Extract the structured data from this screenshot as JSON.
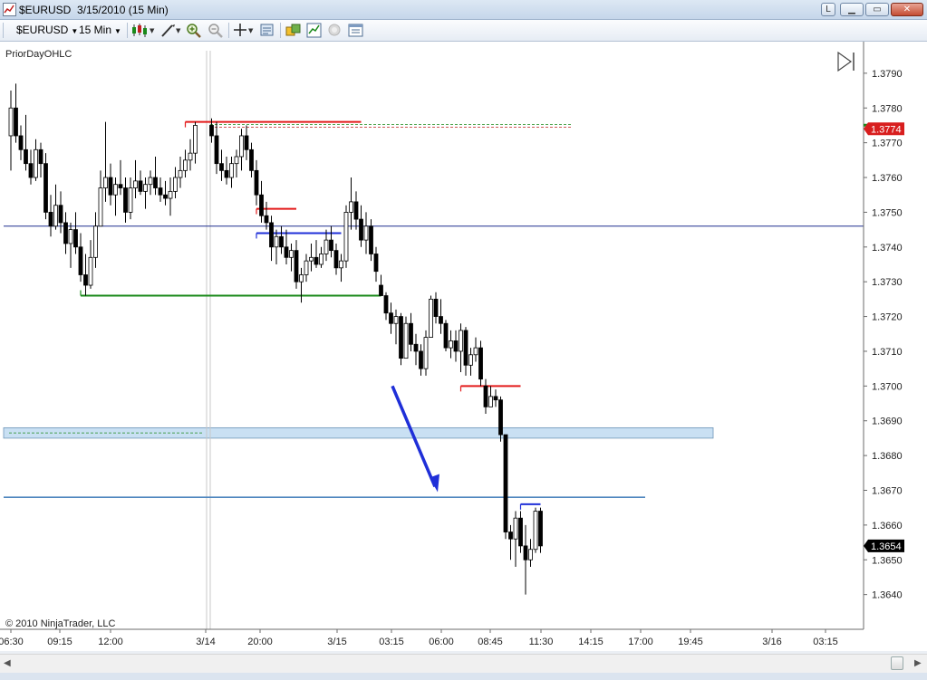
{
  "window": {
    "title": "$EURUSD  3/15/2010 (15 Min)",
    "buttons": [
      "L",
      "▁",
      "▭",
      "✕"
    ]
  },
  "toolbar": {
    "instrument": "$EURUSD",
    "interval": "15 Min"
  },
  "chart_data": {
    "type": "candlestick",
    "indicator_label": "PriorDayOHLC",
    "copyright": "© 2010 NinjaTrader, LLC",
    "y_ticks": [
      "1.3790",
      "1.3780",
      "1.3770",
      "1.3760",
      "1.3750",
      "1.3740",
      "1.3730",
      "1.3720",
      "1.3710",
      "1.3700",
      "1.3690",
      "1.3680",
      "1.3670",
      "1.3660",
      "1.3650",
      "1.3640"
    ],
    "ylim": [
      1.3636,
      1.3797
    ],
    "x_ticks": [
      "06:30",
      "09:15",
      "12:00",
      "3/14",
      "20:00",
      "3/15",
      "03:15",
      "06:00",
      "08:45",
      "11:30",
      "14:15",
      "17:00",
      "19:45",
      "3/16",
      "03:15"
    ],
    "last_price": "1.3654",
    "ask_marker": "1.3774",
    "colors": {
      "candle": "#000000",
      "red_level": "#e31b1b",
      "green_level": "#1a8a1a",
      "blue_level": "#1f2fd8",
      "navy_line": "#1f2f8f",
      "band": "#c9e0f3",
      "arrow": "#1f2fd8"
    },
    "bars_a": [
      [
        1.3762,
        1.3785,
        1.3772,
        1.378
      ],
      [
        1.377,
        1.3787,
        1.378,
        1.3772
      ],
      [
        1.3765,
        1.3775,
        1.3772,
        1.3768
      ],
      [
        1.3762,
        1.3778,
        1.3768,
        1.3764
      ],
      [
        1.3758,
        1.3768,
        1.3764,
        1.376
      ],
      [
        1.3759,
        1.3771,
        1.376,
        1.3768
      ],
      [
        1.376,
        1.377,
        1.3768,
        1.3764
      ],
      [
        1.3748,
        1.3767,
        1.3764,
        1.375
      ],
      [
        1.3743,
        1.3755,
        1.375,
        1.3746
      ],
      [
        1.3745,
        1.3758,
        1.3746,
        1.3752
      ],
      [
        1.3744,
        1.3756,
        1.3752,
        1.3747
      ],
      [
        1.3738,
        1.375,
        1.3747,
        1.3741
      ],
      [
        1.3734,
        1.3747,
        1.3741,
        1.3745
      ],
      [
        1.3738,
        1.375,
        1.3745,
        1.374
      ],
      [
        1.373,
        1.3744,
        1.374,
        1.3732
      ],
      [
        1.3726,
        1.3738,
        1.3732,
        1.3729
      ],
      [
        1.3728,
        1.3742,
        1.3729,
        1.3737
      ],
      [
        1.3734,
        1.375,
        1.3737,
        1.3746
      ],
      [
        1.3746,
        1.3762,
        1.3746,
        1.3757
      ],
      [
        1.3753,
        1.3776,
        1.3757,
        1.376
      ],
      [
        1.3752,
        1.3764,
        1.376,
        1.3755
      ],
      [
        1.3749,
        1.376,
        1.3755,
        1.3758
      ],
      [
        1.3755,
        1.3765,
        1.3758,
        1.3757
      ],
      [
        1.3747,
        1.376,
        1.3757,
        1.375
      ],
      [
        1.3748,
        1.376,
        1.375,
        1.3757
      ],
      [
        1.3754,
        1.3765,
        1.3757,
        1.3759
      ],
      [
        1.3755,
        1.3762,
        1.3759,
        1.3756
      ],
      [
        1.3751,
        1.376,
        1.3756,
        1.3758
      ],
      [
        1.3755,
        1.3762,
        1.3758,
        1.376
      ],
      [
        1.3755,
        1.3766,
        1.376,
        1.3757
      ],
      [
        1.3753,
        1.376,
        1.3757,
        1.3755
      ],
      [
        1.3752,
        1.3759,
        1.3755,
        1.3754
      ],
      [
        1.3749,
        1.376,
        1.3754,
        1.3756
      ],
      [
        1.3754,
        1.3763,
        1.3756,
        1.376
      ],
      [
        1.3757,
        1.3766,
        1.376,
        1.3762
      ],
      [
        1.376,
        1.3768,
        1.3762,
        1.3765
      ],
      [
        1.3762,
        1.3771,
        1.3765,
        1.3767
      ],
      [
        1.3764,
        1.3776,
        1.3767,
        1.3775
      ]
    ],
    "bars_b": [
      [
        1.377,
        1.3777,
        1.3775,
        1.3772
      ],
      [
        1.3761,
        1.3776,
        1.3772,
        1.3764
      ],
      [
        1.3759,
        1.3768,
        1.3764,
        1.3762
      ],
      [
        1.3758,
        1.3766,
        1.3762,
        1.376
      ],
      [
        1.3757,
        1.3766,
        1.376,
        1.3764
      ],
      [
        1.376,
        1.3768,
        1.3764,
        1.3766
      ],
      [
        1.3762,
        1.3774,
        1.3766,
        1.3772
      ],
      [
        1.3765,
        1.3775,
        1.3772,
        1.3768
      ],
      [
        1.376,
        1.377,
        1.3768,
        1.3762
      ],
      [
        1.3752,
        1.3765,
        1.3762,
        1.3755
      ],
      [
        1.3747,
        1.3759,
        1.3755,
        1.3749
      ],
      [
        1.3745,
        1.3753,
        1.3749,
        1.3747
      ],
      [
        1.3736,
        1.3749,
        1.3747,
        1.374
      ],
      [
        1.3735,
        1.3745,
        1.374,
        1.3743
      ],
      [
        1.3738,
        1.3746,
        1.3743,
        1.374
      ],
      [
        1.3735,
        1.3745,
        1.374,
        1.3737
      ],
      [
        1.3733,
        1.3741,
        1.3737,
        1.3739
      ],
      [
        1.3728,
        1.3742,
        1.3739,
        1.373
      ],
      [
        1.3724,
        1.3734,
        1.373,
        1.3732
      ],
      [
        1.373,
        1.3738,
        1.3732,
        1.3736
      ],
      [
        1.3733,
        1.3741,
        1.3736,
        1.3737
      ],
      [
        1.3734,
        1.3742,
        1.3737,
        1.3735
      ],
      [
        1.3734,
        1.374,
        1.3735,
        1.3738
      ],
      [
        1.3736,
        1.3745,
        1.3738,
        1.3742
      ],
      [
        1.3737,
        1.3746,
        1.3742,
        1.3739
      ],
      [
        1.3732,
        1.3741,
        1.3739,
        1.3734
      ],
      [
        1.373,
        1.3738,
        1.3734,
        1.3736
      ],
      [
        1.3734,
        1.3752,
        1.3736,
        1.375
      ],
      [
        1.3745,
        1.376,
        1.375,
        1.3753
      ],
      [
        1.3745,
        1.3756,
        1.3753,
        1.3748
      ],
      [
        1.374,
        1.3752,
        1.3748,
        1.3742
      ],
      [
        1.3738,
        1.375,
        1.3742,
        1.3746
      ],
      [
        1.3736,
        1.3748,
        1.3746,
        1.3738
      ],
      [
        1.373,
        1.374,
        1.3738,
        1.3733
      ],
      [
        1.3728,
        1.3732,
        1.3729,
        1.3726
      ],
      [
        1.3719,
        1.3727,
        1.3726,
        1.3721
      ],
      [
        1.3715,
        1.3724,
        1.3721,
        1.3718
      ],
      [
        1.3712,
        1.3722,
        1.3718,
        1.372
      ],
      [
        1.3706,
        1.3721,
        1.372,
        1.3708
      ],
      [
        1.3708,
        1.372,
        1.3708,
        1.3718
      ],
      [
        1.371,
        1.3721,
        1.3718,
        1.3712
      ],
      [
        1.3706,
        1.3715,
        1.3712,
        1.371
      ],
      [
        1.3703,
        1.3712,
        1.371,
        1.3705
      ],
      [
        1.3703,
        1.3716,
        1.3705,
        1.3714
      ],
      [
        1.3714,
        1.3726,
        1.3714,
        1.3725
      ],
      [
        1.3718,
        1.3727,
        1.3725,
        1.372
      ],
      [
        1.3715,
        1.3725,
        1.372,
        1.3718
      ],
      [
        1.371,
        1.3719,
        1.3718,
        1.3711
      ],
      [
        1.3708,
        1.3716,
        1.3711,
        1.3713
      ],
      [
        1.3707,
        1.3716,
        1.3713,
        1.371
      ],
      [
        1.3704,
        1.3718,
        1.371,
        1.3716
      ],
      [
        1.3703,
        1.3717,
        1.3716,
        1.3706
      ],
      [
        1.3703,
        1.3711,
        1.3706,
        1.3709
      ],
      [
        1.3707,
        1.3714,
        1.3709,
        1.3711
      ],
      [
        1.37,
        1.3713,
        1.3711,
        1.3702
      ],
      [
        1.3692,
        1.3702,
        1.37,
        1.3694
      ],
      [
        1.3694,
        1.37,
        1.3694,
        1.3697
      ],
      [
        1.3694,
        1.3699,
        1.3697,
        1.3696
      ],
      [
        1.3684,
        1.3697,
        1.3696,
        1.3686
      ],
      [
        1.3656,
        1.3686,
        1.3686,
        1.3658
      ],
      [
        1.365,
        1.366,
        1.3658,
        1.3656
      ],
      [
        1.3648,
        1.3664,
        1.3656,
        1.3662
      ],
      [
        1.3652,
        1.3664,
        1.3662,
        1.3654
      ],
      [
        1.364,
        1.366,
        1.3654,
        1.365
      ],
      [
        1.3648,
        1.3656,
        1.365,
        1.3653
      ],
      [
        1.3652,
        1.3665,
        1.3653,
        1.3664
      ],
      [
        1.3652,
        1.3665,
        1.3664,
        1.3654
      ]
    ],
    "levels": [
      {
        "kind": "red",
        "value": 1.3776,
        "from": "bars_a:35",
        "to": "bars_b:30"
      },
      {
        "kind": "green",
        "value": 1.3726,
        "from": "bars_a:14",
        "to": "bars_b:34"
      },
      {
        "kind": "red",
        "value": 1.3751,
        "from": "bars_b:9",
        "to": "bars_b:17"
      },
      {
        "kind": "blue",
        "value": 1.3744,
        "from": "bars_b:9",
        "to": "bars_b:26"
      },
      {
        "kind": "red",
        "value": 1.37,
        "from": "bars_b:50",
        "to": "bars_b:62"
      },
      {
        "kind": "blue",
        "value": 1.3666,
        "from": "bars_b:62",
        "to": "bars_b:72"
      }
    ],
    "horizontal_lines": [
      {
        "kind": "navy",
        "value": 1.3746
      },
      {
        "kind": "steel",
        "value": 1.3668
      }
    ],
    "band": {
      "from": 1.3685,
      "to": 1.3688
    },
    "arrow": {
      "from": 1.37,
      "to": 1.367
    },
    "session_break": "3/14"
  }
}
